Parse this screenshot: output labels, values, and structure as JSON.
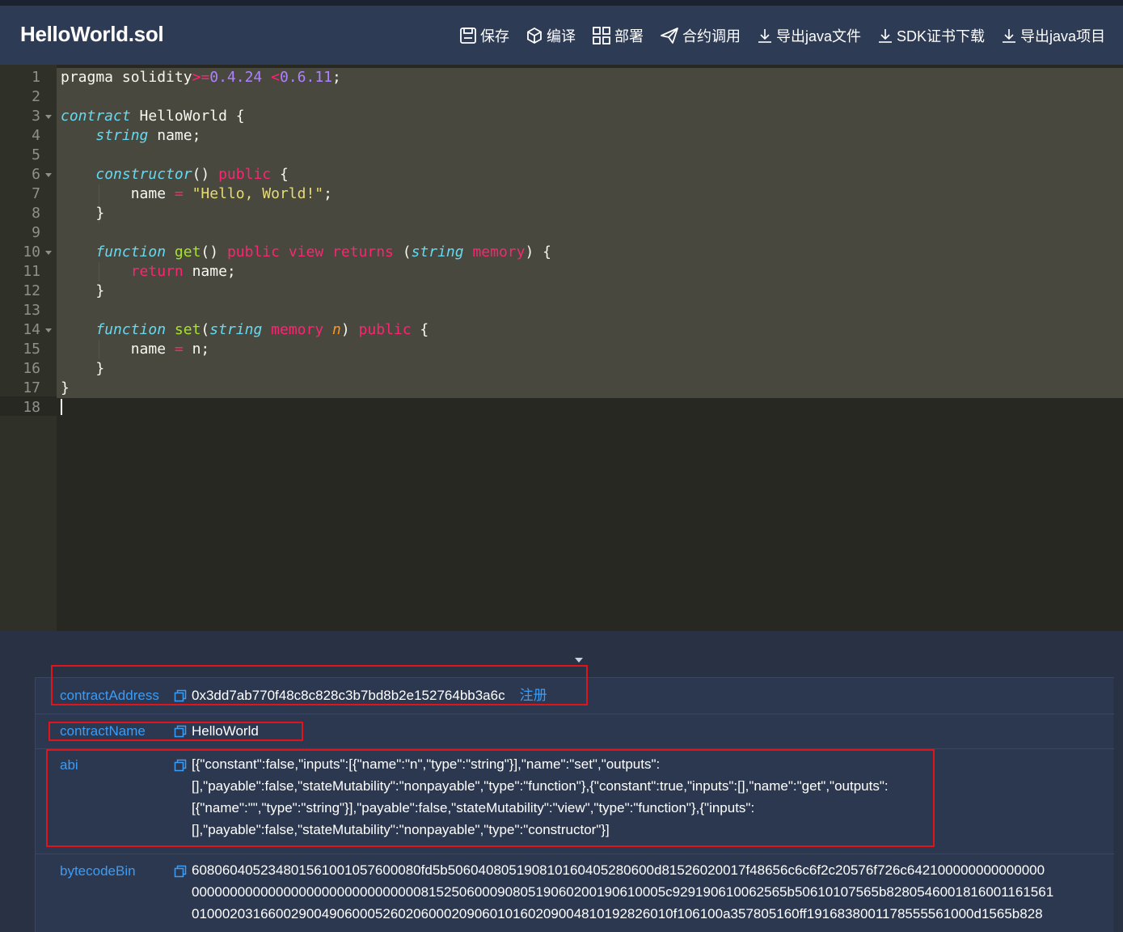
{
  "header": {
    "filename": "HelloWorld.sol",
    "toolbar": [
      {
        "icon": "save-icon",
        "label": "保存"
      },
      {
        "icon": "cube-icon",
        "label": "编译"
      },
      {
        "icon": "grid-icon",
        "label": "部署"
      },
      {
        "icon": "send-icon",
        "label": "合约调用"
      },
      {
        "icon": "download-icon",
        "label": "导出java文件"
      },
      {
        "icon": "download-icon",
        "label": "SDK证书下载"
      },
      {
        "icon": "download-icon",
        "label": "导出java项目"
      }
    ]
  },
  "editor": {
    "line_numbers": [
      "1",
      "2",
      "3",
      "4",
      "5",
      "6",
      "7",
      "8",
      "9",
      "10",
      "11",
      "12",
      "13",
      "14",
      "15",
      "16",
      "17",
      "18"
    ],
    "lines": [
      "pragma solidity>=0.4.24 <0.6.11;",
      "",
      "contract HelloWorld {",
      "    string name;",
      "",
      "    constructor() public {",
      "        name = \"Hello, World!\";",
      "    }",
      "",
      "    function get() public view returns (string memory) {",
      "        return name;",
      "    }",
      "",
      "    function set(string memory n) public {",
      "        name = n;",
      "    }",
      "}",
      ""
    ]
  },
  "result": {
    "contract_address": {
      "key": "contractAddress",
      "value": "0x3dd7ab770f48c8c828c3b7bd8b2e152764bb3a6c",
      "action": "注册"
    },
    "contract_name": {
      "key": "contractName",
      "value": "HelloWorld"
    },
    "abi": {
      "key": "abi",
      "lines": [
        "[{\"constant\":false,\"inputs\":[{\"name\":\"n\",\"type\":\"string\"}],\"name\":\"set\",\"outputs\":",
        "[],\"payable\":false,\"stateMutability\":\"nonpayable\",\"type\":\"function\"},{\"constant\":true,\"inputs\":[],\"name\":\"get\",\"outputs\":",
        "[{\"name\":\"\",\"type\":\"string\"}],\"payable\":false,\"stateMutability\":\"view\",\"type\":\"function\"},{\"inputs\":",
        "[],\"payable\":false,\"stateMutability\":\"nonpayable\",\"type\":\"constructor\"}]"
      ]
    },
    "bytecode_bin": {
      "key": "bytecodeBin",
      "lines": [
        "608060405234801561001057600080fd5b506040805190810160405280600d81526020017f48656c6c6f2c20576f726c642100000000000000",
        "00000000000000000000000000000081525060009080519060200190610005c929190610062565b50610107565b8280546001816001161561",
        "010002031660029004906000526020600020906010160209004810192826010f106100a357805160ff1916838001178555561000d1565b828"
      ]
    }
  },
  "colors": {
    "accent": "#3b9cf5",
    "highlight_box": "#e0141b",
    "header_bg": "#2e3b55",
    "editor_bg": "#272822"
  }
}
